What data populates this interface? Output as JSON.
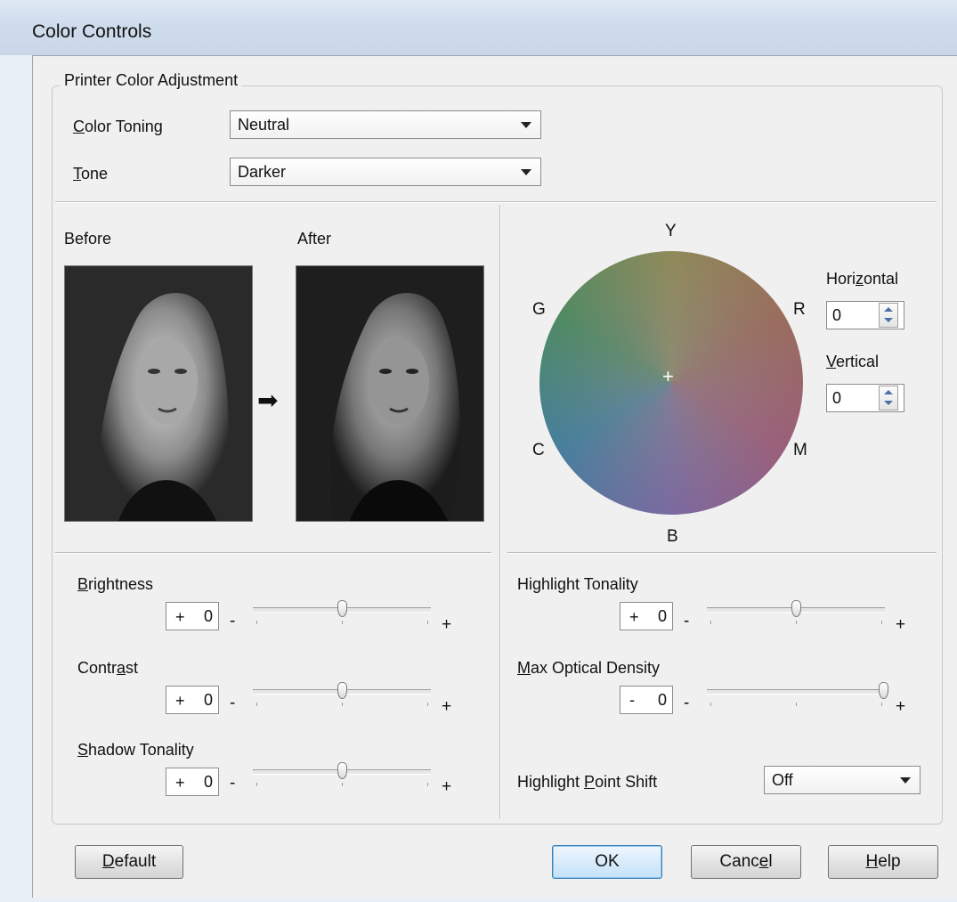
{
  "window": {
    "title": "Color Controls"
  },
  "group": {
    "legend": "Printer Color Adjustment"
  },
  "color_toning": {
    "label_pre": "",
    "label_u": "C",
    "label_post": "olor Toning",
    "value": "Neutral"
  },
  "tone": {
    "label_pre": "",
    "label_u": "T",
    "label_post": "one",
    "value": "Darker"
  },
  "preview": {
    "before_label": "Before",
    "after_label": "After",
    "arrow": "➡"
  },
  "wheel": {
    "labels": {
      "y": "Y",
      "r": "R",
      "m": "M",
      "b": "B",
      "c": "C",
      "g": "G"
    },
    "center_mark": "+",
    "horizontal": {
      "label_pre": "Hori",
      "label_u": "z",
      "label_post": "ontal",
      "value": "0"
    },
    "vertical": {
      "label_pre": "",
      "label_u": "V",
      "label_post": "ertical",
      "value": "0"
    }
  },
  "sliders": {
    "brightness": {
      "label_pre": "",
      "label_u": "B",
      "label_post": "rightness",
      "sign": "+",
      "value": "0",
      "level": 0.5
    },
    "contrast": {
      "label_pre": "Contr",
      "label_u": "a",
      "label_post": "st",
      "sign": "+",
      "value": "0",
      "level": 0.5
    },
    "shadow_tonality": {
      "label_pre": "",
      "label_u": "S",
      "label_post": "hadow Tonality",
      "sign": "+",
      "value": "0",
      "level": 0.5
    },
    "highlight_tonality": {
      "label_pre": "Highli",
      "label_u": "g",
      "label_post": "ht Tonality",
      "sign": "+",
      "value": "0",
      "level": 0.5
    },
    "max_optical_density": {
      "label_pre": "",
      "label_u": "M",
      "label_post": "ax Optical Density",
      "sign": "-",
      "value": "0",
      "level": 1.0
    },
    "min_symbol": "-",
    "max_symbol": "+"
  },
  "highlight_point_shift": {
    "label_pre": "Highlight ",
    "label_u": "P",
    "label_post": "oint Shift",
    "value": "Off"
  },
  "buttons": {
    "default": {
      "pre": "",
      "u": "D",
      "post": "efault"
    },
    "ok": {
      "pre": "OK",
      "u": "",
      "post": ""
    },
    "cancel": {
      "pre": "Canc",
      "u": "e",
      "post": "l"
    },
    "help": {
      "pre": "",
      "u": "H",
      "post": "elp"
    }
  },
  "colors": {
    "window_bg": "#f0f0f0",
    "title_bg": "#cfdcec",
    "accent": "#3c7fb1"
  }
}
